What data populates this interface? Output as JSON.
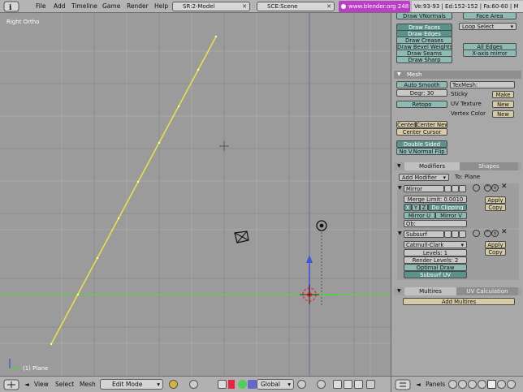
{
  "menubar": {
    "menus": [
      "File",
      "Add",
      "Timeline",
      "Game",
      "Render",
      "Help"
    ],
    "screen_field": "SR:2-Model",
    "scene_field": "SCE:Scene",
    "url": "www.blender.org 248",
    "stats": "Ve:93-93 | Ed:152-152 | Fa:60-60 | M"
  },
  "viewport": {
    "view_label": "Right Ortho",
    "object_label": "(1) Plane"
  },
  "view_header": {
    "view": "View",
    "select": "Select",
    "mesh": "Mesh",
    "mode": "Edit Mode",
    "orientation": "Global"
  },
  "mesh_tools": {
    "draw_vnormals": "Draw VNormals",
    "face_area": "Face Area",
    "draw_faces": "Draw Faces",
    "draw_edges": "Draw Edges",
    "draw_creases": "Draw Creases",
    "draw_bevel_weights": "Draw Bevel Weights",
    "draw_seams": "Draw Seams",
    "draw_sharp": "Draw Sharp",
    "loop_select": "Loop Select",
    "all_edges": "All Edges",
    "x_axis_mirror": "X-axis mirror"
  },
  "mesh_panel": {
    "title": "Mesh",
    "auto_smooth": "Auto Smooth",
    "degr": "Degr: 30",
    "texmesh": "TexMesh:",
    "sticky": "Sticky",
    "make1": "Make",
    "uv_texture": "UV Texture",
    "new1": "New",
    "vertex_color": "Vertex Color",
    "new2": "New",
    "retopo": "Retopo",
    "center": "Center",
    "center_new": "Center New",
    "center_cursor": "Center Cursor",
    "double_sided": "Double Sided",
    "no_vnormal_flip": "No V.Normal Flip"
  },
  "modifiers_panel": {
    "tab_modifiers": "Modifiers",
    "tab_shapes": "Shapes",
    "add_modifier": "Add Modifier",
    "to_plane": "To: Plane",
    "mirror": {
      "name": "Mirror",
      "merge_limit": "Merge Limit: 0.0010",
      "x": "X",
      "y": "Y",
      "z": "Z",
      "do_clipping": "Do Clipping",
      "mirror_u": "Mirror U",
      "mirror_v": "Mirror V",
      "ob": "Ob:",
      "apply": "Apply",
      "copy": "Copy"
    },
    "subsurf": {
      "name": "Subsurf",
      "type": "Catmull-Clark",
      "levels": "Levels: 1",
      "render_levels": "Render Levels: 2",
      "optimal_draw": "Optimal Draw",
      "subsurf_uv": "Subsurf UV",
      "apply": "Apply",
      "copy": "Copy"
    }
  },
  "multires_panel": {
    "tab_multires": "Multires",
    "tab_uv": "UV Calculation",
    "add_multires": "Add Multires"
  },
  "panel_header": {
    "panels": "Panels"
  }
}
